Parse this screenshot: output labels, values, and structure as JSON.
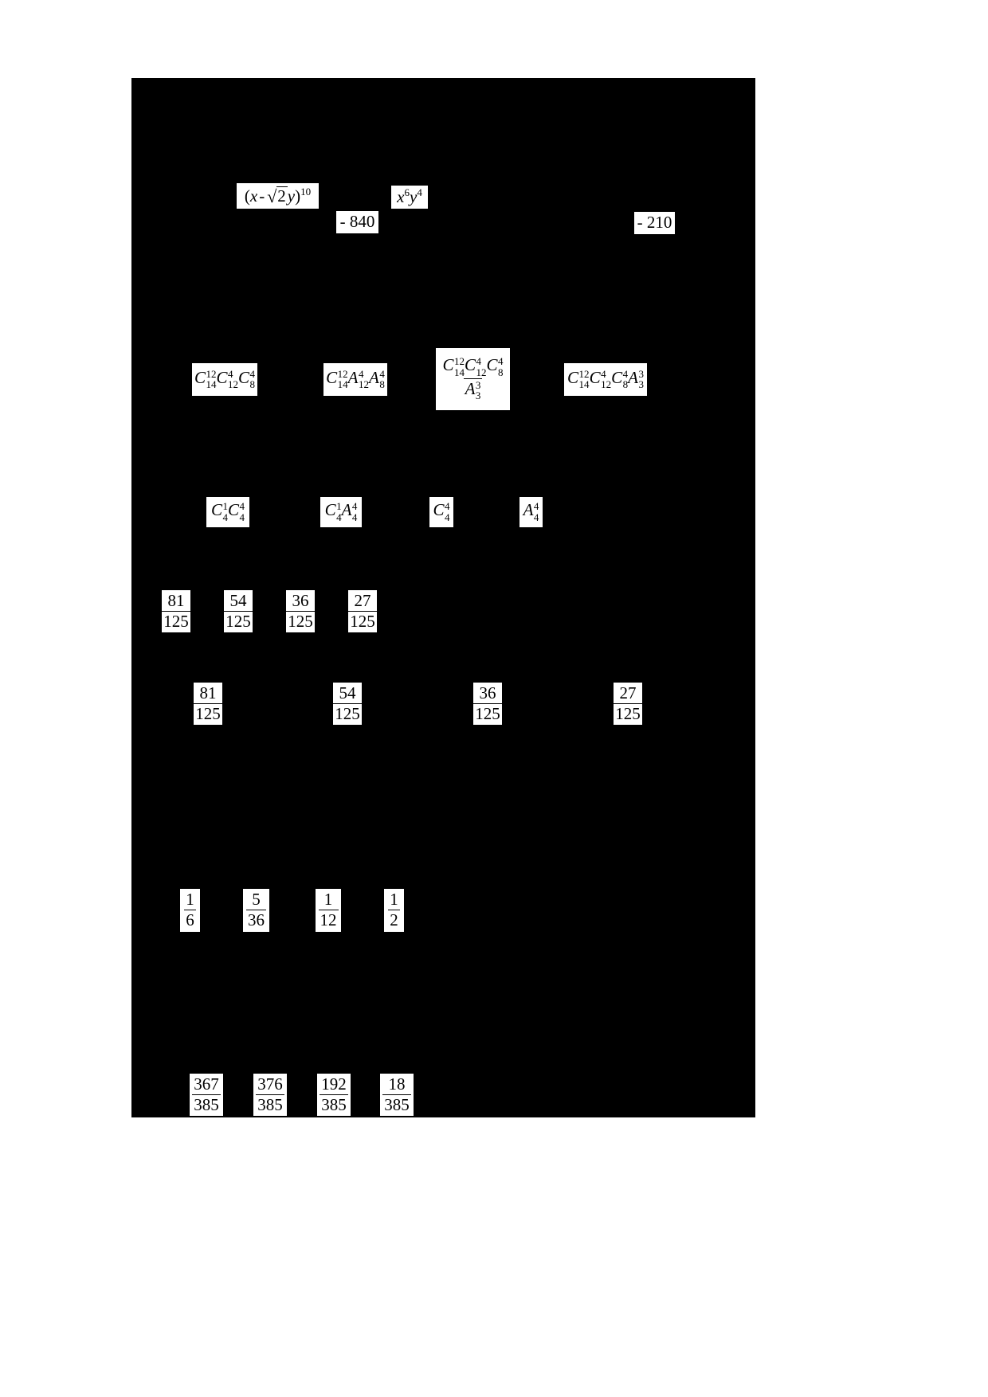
{
  "page": {
    "background_color": "#000000",
    "chip_background_color": "#ffffff",
    "text_color": "#000000"
  },
  "rows": {
    "binomial": {
      "expression_label": "(x - √2y)¹⁰",
      "expr_open": "(",
      "expr_var_x": "x",
      "expr_minus": "-",
      "expr_radical": "√",
      "expr_radicand": "2",
      "expr_var_y": "y",
      "expr_close": ")",
      "expr_power": "10",
      "coefficient": "- 840",
      "term_base_x": "x",
      "term_exp_x": "6",
      "term_base_y": "y",
      "term_exp_y": "4",
      "term_label": "x⁶y⁴",
      "answer_right": "- 210"
    },
    "combinatorics_group": {
      "item1": {
        "label": "C₁₄¹²C₁₂⁴C₈⁴",
        "parts": [
          {
            "symbol": "C",
            "upper": "12",
            "lower": "14"
          },
          {
            "symbol": "C",
            "upper": "4",
            "lower": "12"
          },
          {
            "symbol": "C",
            "upper": "4",
            "lower": "8"
          }
        ]
      },
      "item2": {
        "label": "C₁₄¹²A₁₂⁴A₈⁴",
        "parts": [
          {
            "symbol": "C",
            "upper": "12",
            "lower": "14"
          },
          {
            "symbol": "A",
            "upper": "4",
            "lower": "12"
          },
          {
            "symbol": "A",
            "upper": "4",
            "lower": "8"
          }
        ]
      },
      "item3": {
        "label": "C₁₄¹²C₁₂⁴C₈⁴ / A₃³",
        "numerator": [
          {
            "symbol": "C",
            "upper": "12",
            "lower": "14"
          },
          {
            "symbol": "C",
            "upper": "4",
            "lower": "12"
          },
          {
            "symbol": "C",
            "upper": "4",
            "lower": "8"
          }
        ],
        "denominator": [
          {
            "symbol": "A",
            "upper": "3",
            "lower": "3"
          }
        ]
      },
      "item4": {
        "label": "C₁₄¹²C₁₂⁴C₈⁴A₃³",
        "parts": [
          {
            "symbol": "C",
            "upper": "12",
            "lower": "14"
          },
          {
            "symbol": "C",
            "upper": "4",
            "lower": "12"
          },
          {
            "symbol": "C",
            "upper": "4",
            "lower": "8"
          },
          {
            "symbol": "A",
            "upper": "3",
            "lower": "3"
          }
        ]
      }
    },
    "small_combinatorics": {
      "item1": {
        "label": "C₄¹C₄⁴",
        "parts": [
          {
            "symbol": "C",
            "upper": "1",
            "lower": "4"
          },
          {
            "symbol": "C",
            "upper": "4",
            "lower": "4"
          }
        ]
      },
      "item2": {
        "label": "C₄¹A₄⁴",
        "parts": [
          {
            "symbol": "C",
            "upper": "1",
            "lower": "4"
          },
          {
            "symbol": "A",
            "upper": "4",
            "lower": "4"
          }
        ]
      },
      "item3": {
        "label": "C₄⁴",
        "parts": [
          {
            "symbol": "C",
            "upper": "4",
            "lower": "4"
          }
        ]
      },
      "item4": {
        "label": "A₄⁴",
        "parts": [
          {
            "symbol": "A",
            "upper": "4",
            "lower": "4"
          }
        ]
      }
    },
    "fractions_125_tight": [
      {
        "num": "81",
        "den": "125"
      },
      {
        "num": "54",
        "den": "125"
      },
      {
        "num": "36",
        "den": "125"
      },
      {
        "num": "27",
        "den": "125"
      }
    ],
    "fractions_125_spread": [
      {
        "num": "81",
        "den": "125"
      },
      {
        "num": "54",
        "den": "125"
      },
      {
        "num": "36",
        "den": "125"
      },
      {
        "num": "27",
        "den": "125"
      }
    ],
    "fractions_dice": [
      {
        "num": "1",
        "den": "6"
      },
      {
        "num": "5",
        "den": "36"
      },
      {
        "num": "1",
        "den": "12"
      },
      {
        "num": "1",
        "den": "2"
      }
    ],
    "fractions_385": [
      {
        "num": "367",
        "den": "385"
      },
      {
        "num": "376",
        "den": "385"
      },
      {
        "num": "192",
        "den": "385"
      },
      {
        "num": "18",
        "den": "385"
      }
    ]
  }
}
